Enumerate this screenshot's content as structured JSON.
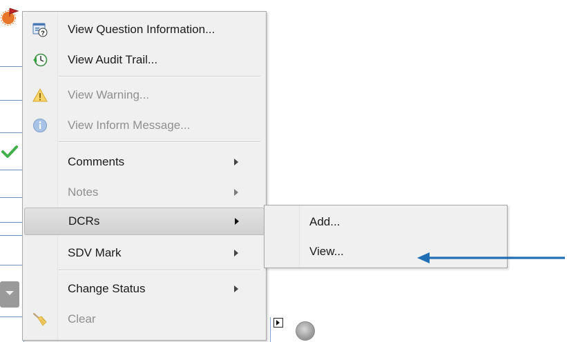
{
  "context_menu": {
    "items": [
      {
        "label": "View Question Information...",
        "icon": "question-info-icon",
        "enabled": true
      },
      {
        "label": "View Audit Trail...",
        "icon": "audit-trail-clock-icon",
        "enabled": true
      },
      {
        "label": "View Warning...",
        "icon": "warning-icon",
        "enabled": false
      },
      {
        "label": "View Inform Message...",
        "icon": "info-icon",
        "enabled": false
      },
      {
        "label": "Comments",
        "enabled": true,
        "submenu": true
      },
      {
        "label": "Notes",
        "enabled": false,
        "submenu": true
      },
      {
        "label": "DCRs",
        "enabled": true,
        "submenu": true,
        "highlighted": true
      },
      {
        "label": "SDV Mark",
        "enabled": true,
        "submenu": true
      },
      {
        "label": "Change Status",
        "enabled": true,
        "submenu": true
      },
      {
        "label": "Clear",
        "icon": "broom-icon",
        "enabled": false
      }
    ]
  },
  "dcrs_submenu": {
    "items": [
      {
        "label": "Add..."
      },
      {
        "label": "View..."
      }
    ]
  },
  "colors": {
    "callout_arrow": "#1f6fb5",
    "menu_bg": "#f0f0f0",
    "disabled_text": "#8f8f8f"
  }
}
